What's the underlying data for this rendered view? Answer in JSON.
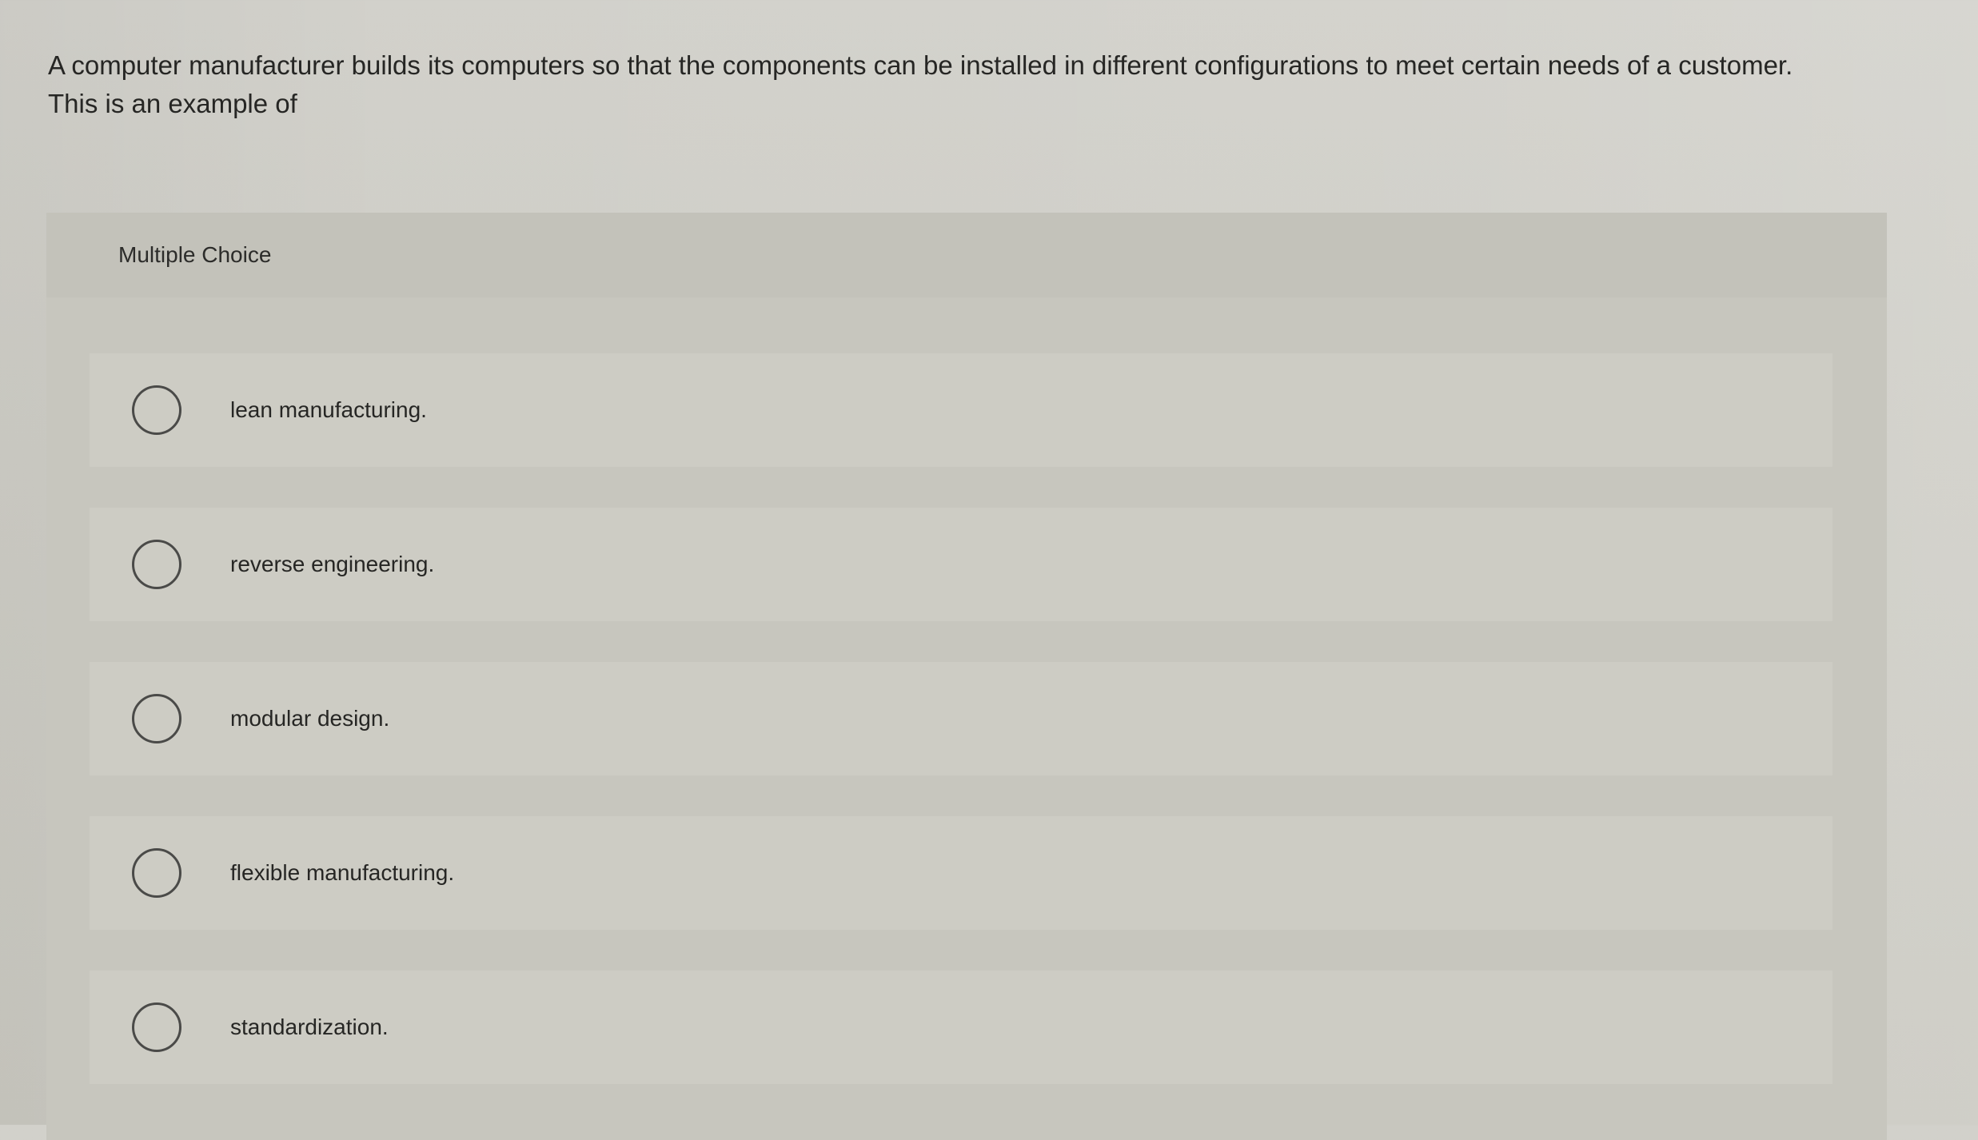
{
  "question": {
    "line1": "A computer manufacturer builds its computers so that the components can be installed in different configurations to meet certain needs of a customer.",
    "line2": "This is an example of"
  },
  "multiple_choice": {
    "title": "Multiple Choice",
    "options": [
      {
        "label": "lean manufacturing.",
        "selected": false
      },
      {
        "label": "reverse engineering.",
        "selected": false
      },
      {
        "label": "modular design.",
        "selected": false
      },
      {
        "label": "flexible manufacturing.",
        "selected": false
      },
      {
        "label": "standardization.",
        "selected": false
      }
    ]
  }
}
